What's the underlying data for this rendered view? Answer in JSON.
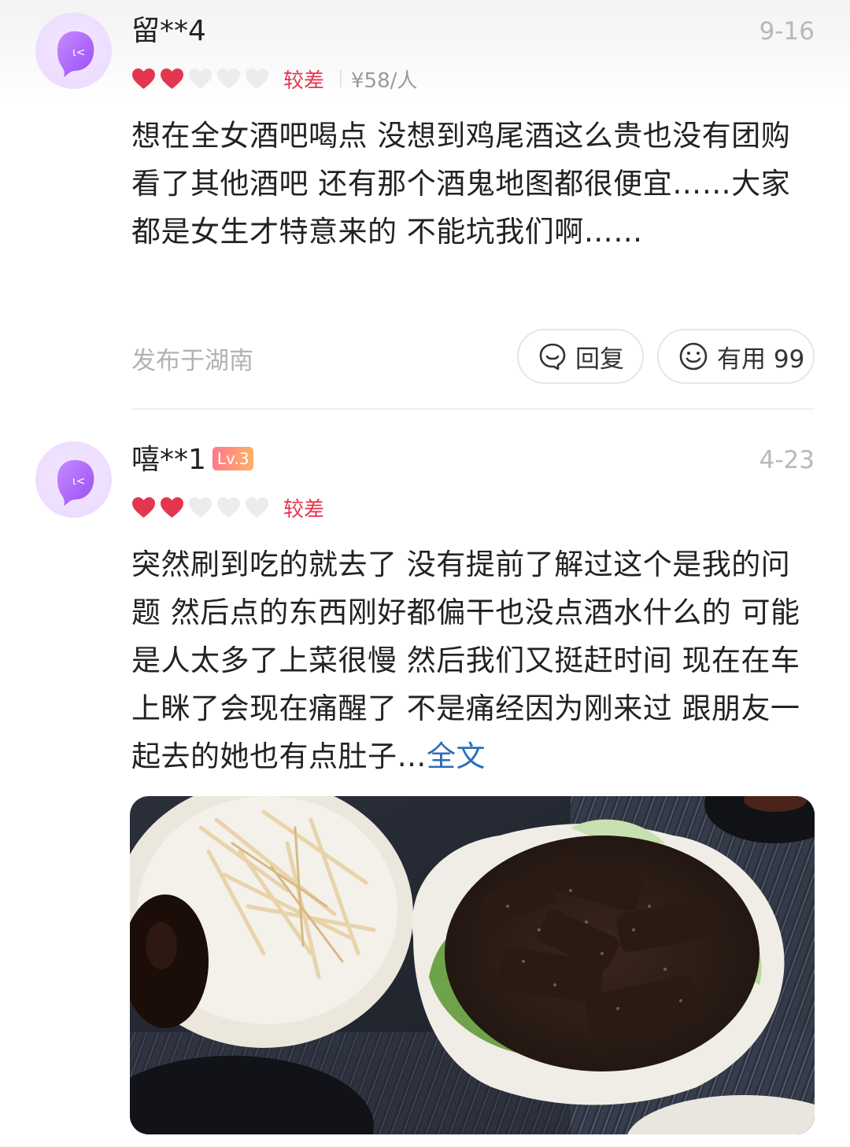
{
  "reviews": [
    {
      "username": "留**4",
      "date": "9-16",
      "rating_label": "较差",
      "hearts_filled": 2,
      "hearts_total": 5,
      "price": "¥58/人",
      "text": "想在全女酒吧喝点  没想到鸡尾酒这么贵也没有团购  看了其他酒吧 还有那个酒鬼地图都很便宜……大家都是女生才特意来的  不能坑我们啊……",
      "location": "发布于湖南",
      "reply_label": "回复",
      "useful_label": "有用 99"
    },
    {
      "username": "嘻**1",
      "level": "Lv.3",
      "date": "4-23",
      "rating_label": "较差",
      "hearts_filled": 2,
      "hearts_total": 5,
      "text": "突然刷到吃的就去了 没有提前了解过这个是我的问题  然后点的东西刚好都偏干也没点酒水什么的 可能是人太多了上菜很慢 然后我们又挺赶时间 现在在车上眯了会现在痛醒了 不是痛经因为刚来过  跟朋友一起去的她也有点肚子…",
      "more_label": "全文"
    }
  ],
  "colors": {
    "heart_filled": "#e5364f",
    "heart_empty": "#ececec",
    "link": "#2a6fb8",
    "muted": "#b3b3b3"
  },
  "icons": [
    "avatar-ghost-icon",
    "heart-icon",
    "reply-bubble-icon",
    "smile-icon"
  ]
}
